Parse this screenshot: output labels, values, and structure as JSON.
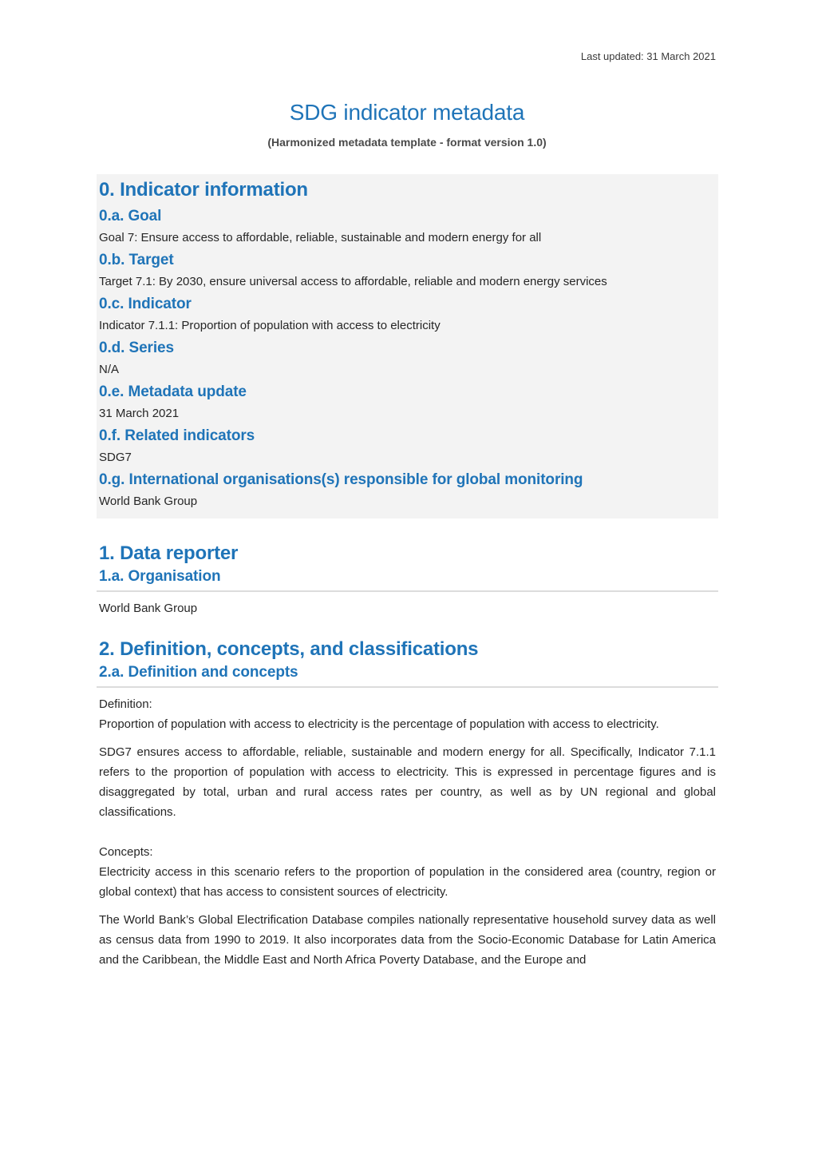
{
  "header": {
    "last_updated": "Last updated: 31 March 2021",
    "title": "SDG indicator metadata",
    "subtitle": "(Harmonized metadata template - format version 1.0)"
  },
  "section0": {
    "title": "0. Indicator information",
    "items": [
      {
        "heading": "0.a. Goal",
        "value": "Goal 7: Ensure access to affordable, reliable, sustainable and modern energy for all"
      },
      {
        "heading": "0.b. Target",
        "value": "Target 7.1: By 2030, ensure universal access to affordable, reliable and modern energy services"
      },
      {
        "heading": "0.c. Indicator",
        "value": "Indicator 7.1.1: Proportion of population with access to electricity"
      },
      {
        "heading": "0.d. Series",
        "value": "N/A"
      },
      {
        "heading": "0.e. Metadata update",
        "value": "31 March 2021"
      },
      {
        "heading": "0.f. Related indicators",
        "value": "SDG7"
      },
      {
        "heading": "0.g. International organisations(s) responsible for global monitoring",
        "value": "World Bank Group"
      }
    ]
  },
  "section1": {
    "title": "1. Data reporter",
    "subsection": {
      "heading": "1.a. Organisation",
      "value": "World Bank Group"
    }
  },
  "section2": {
    "title": "2. Definition, concepts, and classifications",
    "subsection": {
      "heading": "2.a. Definition and concepts",
      "definition_label": "Definition:",
      "definition_text": "Proportion of population with access to electricity is the percentage of population with access to electricity.",
      "paragraph1": "SDG7 ensures access to affordable, reliable, sustainable and modern energy for all. Specifically, Indicator 7.1.1 refers to the proportion of population with access to electricity. This is expressed in percentage figures and is disaggregated by total, urban and rural access rates per country, as well as by UN regional and global classifications.",
      "concepts_label": "Concepts:",
      "concepts_text": "Electricity access in this scenario refers to the proportion of population in the considered area (country, region or global context) that has access to consistent sources of electricity.",
      "paragraph2": "The World Bank’s Global Electrification Database compiles nationally representative household survey data as well as census data from 1990 to 2019. It also incorporates data from the Socio-Economic Database for Latin America and the Caribbean, the Middle East and North Africa Poverty Database, and the Europe and"
    }
  }
}
